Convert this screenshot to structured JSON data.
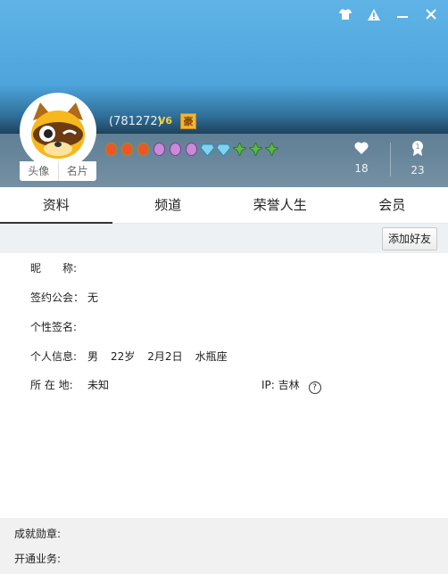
{
  "window": {
    "controls": [
      "shirt-icon",
      "warning-icon",
      "minimize-icon",
      "close-icon"
    ]
  },
  "profile": {
    "avatar_tabs": [
      "头像",
      "名片"
    ],
    "uid": "(781272)",
    "badge_v": "V6",
    "badge_hao": "豪",
    "medals": [
      "red",
      "red",
      "red",
      "purple",
      "purple",
      "purple",
      "blue",
      "blue",
      "green",
      "green",
      "green"
    ]
  },
  "stats": {
    "likes": "18",
    "honor": "23"
  },
  "tabs": [
    "资料",
    "频道",
    "荣誉人生",
    "会员"
  ],
  "toolbar": {
    "add_friend": "添加好友"
  },
  "info": {
    "nickname_label": "昵　　称:",
    "guild_label": "签约公会：",
    "guild_value": "无",
    "signature_label": "个性签名:",
    "personal_label": "个人信息:",
    "gender": "男",
    "age": "22岁",
    "birthday": "2月2日",
    "zodiac": "水瓶座",
    "location_label": "所 在 地:",
    "location_value": "未知",
    "ip_label": "IP:",
    "ip_value": "吉林"
  },
  "footer": {
    "achievements_label": "成就勋章:",
    "services_label": "开通业务:"
  },
  "colors": {
    "header_top": "#5fb3e6",
    "header_bottom": "#7590a3"
  }
}
